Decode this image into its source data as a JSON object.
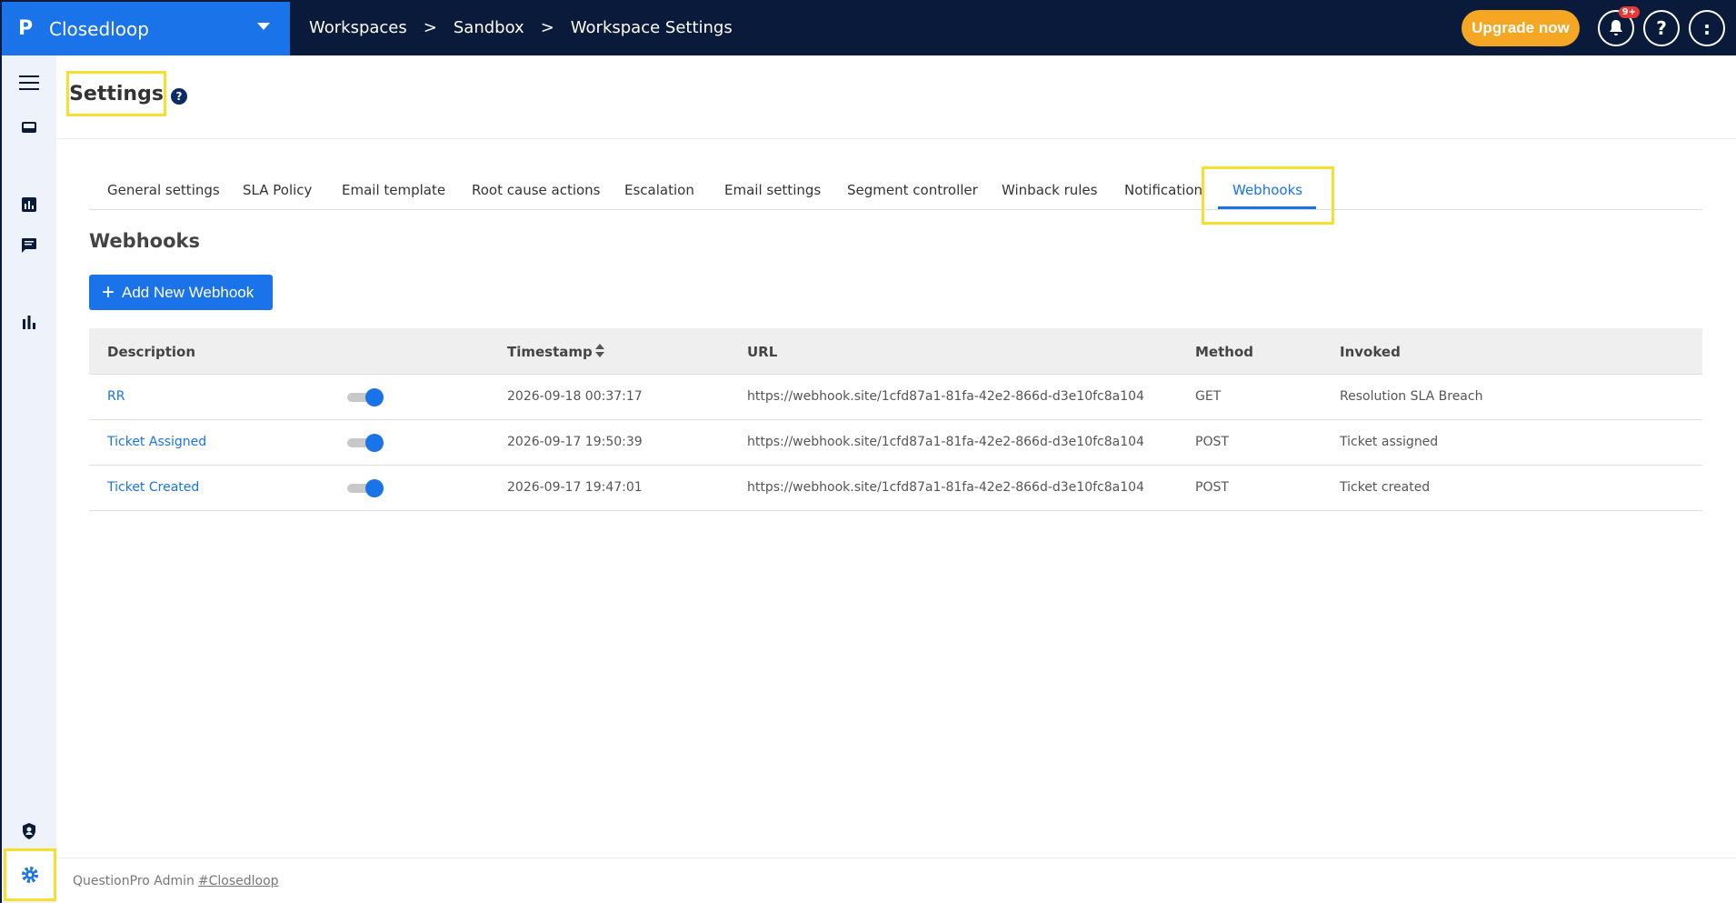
{
  "app": {
    "logo": "P",
    "name": "Closedloop"
  },
  "breadcrumb": {
    "items": [
      "Workspaces",
      "Sandbox",
      "Workspace Settings"
    ],
    "separator": ">"
  },
  "header_right": {
    "upgrade_label": "Upgrade now",
    "notifications_badge": "9+",
    "help_glyph": "?",
    "avatar_glyph": ":"
  },
  "sidebar": {
    "icons": [
      "menu-icon",
      "inbox-icon",
      "report-icon",
      "chat-icon",
      "analytics-icon",
      "shield-user-icon",
      "gear-icon"
    ]
  },
  "page": {
    "title": "Settings",
    "help_glyph": "?"
  },
  "tabs": [
    {
      "label": "General settings"
    },
    {
      "label": "SLA Policy"
    },
    {
      "label": "Email template"
    },
    {
      "label": "Root cause actions"
    },
    {
      "label": "Escalation"
    },
    {
      "label": "Email settings"
    },
    {
      "label": "Segment controller"
    },
    {
      "label": "Winback rules"
    },
    {
      "label": "Notification"
    },
    {
      "label": "Webhooks",
      "active": true
    }
  ],
  "webhooks": {
    "section_title": "Webhooks",
    "add_button": "Add New Webhook",
    "add_button_plus": "+",
    "columns": {
      "description": "Description",
      "timestamp": "Timestamp",
      "url": "URL",
      "method": "Method",
      "invoked": "Invoked"
    },
    "rows": [
      {
        "description": "RR",
        "enabled": true,
        "timestamp": "2026-09-18 00:37:17",
        "url": "https://webhook.site/1cfd87a1-81fa-42e2-866d-d3e10fc8a104",
        "method": "GET",
        "invoked": "Resolution SLA Breach"
      },
      {
        "description": "Ticket Assigned",
        "enabled": true,
        "timestamp": "2026-09-17 19:50:39",
        "url": "https://webhook.site/1cfd87a1-81fa-42e2-866d-d3e10fc8a104",
        "method": "POST",
        "invoked": "Ticket assigned"
      },
      {
        "description": "Ticket Created",
        "enabled": true,
        "timestamp": "2026-09-17 19:47:01",
        "url": "https://webhook.site/1cfd87a1-81fa-42e2-866d-d3e10fc8a104",
        "method": "POST",
        "invoked": "Ticket created"
      }
    ]
  },
  "footer": {
    "text": "QuestionPro Admin",
    "link": "#Closedloop"
  },
  "colors": {
    "topbar": "#0a1a3a",
    "brand": "#1a73e8",
    "accent": "#1a73e8",
    "upgrade": "#f5a623",
    "highlight": "#f7e02d"
  }
}
